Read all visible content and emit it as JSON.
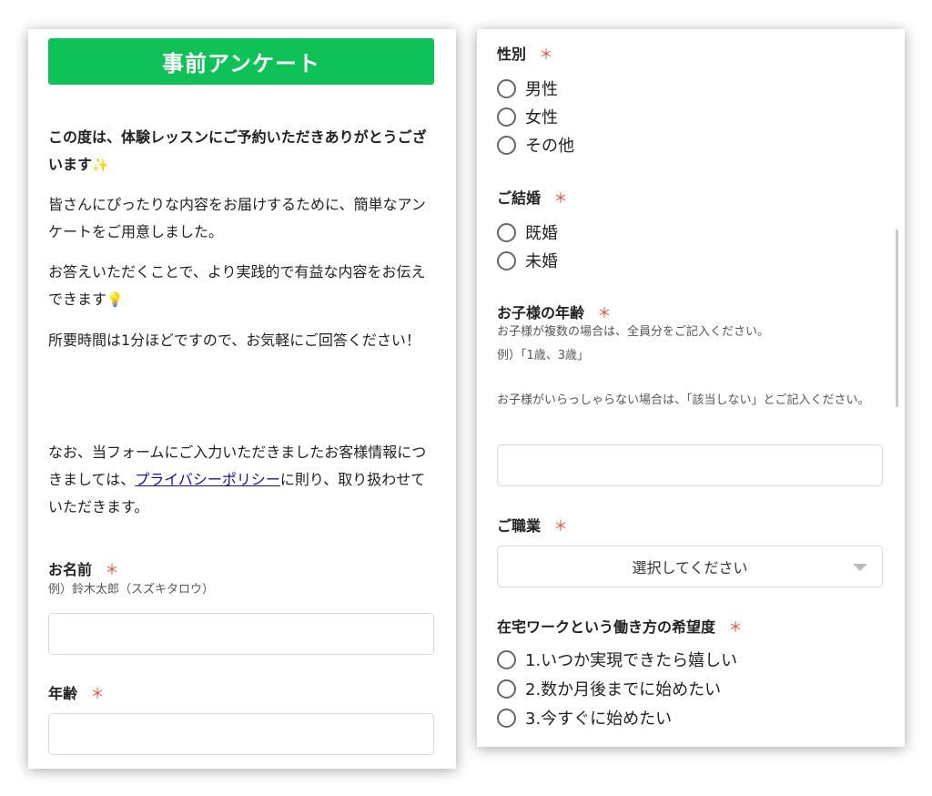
{
  "left": {
    "title": "事前アンケート",
    "intro_bold": "この度は、体験レッスンにご予約いただきありがとうございます",
    "intro_bold_emoji": "✨",
    "para1": "皆さんにぴったりな内容をお届けするために、簡単なアンケートをご用意しました。",
    "para2": "お答えいただくことで、より実践的で有益な内容をお伝えできます",
    "para2_emoji": "💡",
    "para3": "所要時間は1分ほどですので、お気軽にご回答ください！",
    "privacy_before": "なお、当フォームにご入力いただきましたお客様情報につきましては、",
    "privacy_link": "プライバシーポリシー",
    "privacy_after": "に則り、取り扱わせていただきます。",
    "name_label": "お名前",
    "name_hint": "例）鈴木太郎（スズキタロウ）",
    "age_label": "年齢",
    "required_mark": "＊"
  },
  "right": {
    "gender_label": "性別",
    "gender_options": [
      "男性",
      "女性",
      "その他"
    ],
    "marriage_label": "ご結婚",
    "marriage_options": [
      "既婚",
      "未婚"
    ],
    "children_label": "お子様の年齢",
    "children_hint1": "お子様が複数の場合は、全員分をご記入ください。",
    "children_hint2": "例）「1歳、3歳」",
    "children_hint3": "お子様がいらっしゃらない場合は、「該当しない」とご記入ください。",
    "job_label": "ご職業",
    "job_select": "選択してください",
    "remote_label": "在宅ワークという働き方の希望度",
    "remote_options": [
      "1.いつか実現できたら嬉しい",
      "2.数か月後までに始めたい",
      "3.今すぐに始めたい"
    ],
    "required_mark": "＊"
  }
}
